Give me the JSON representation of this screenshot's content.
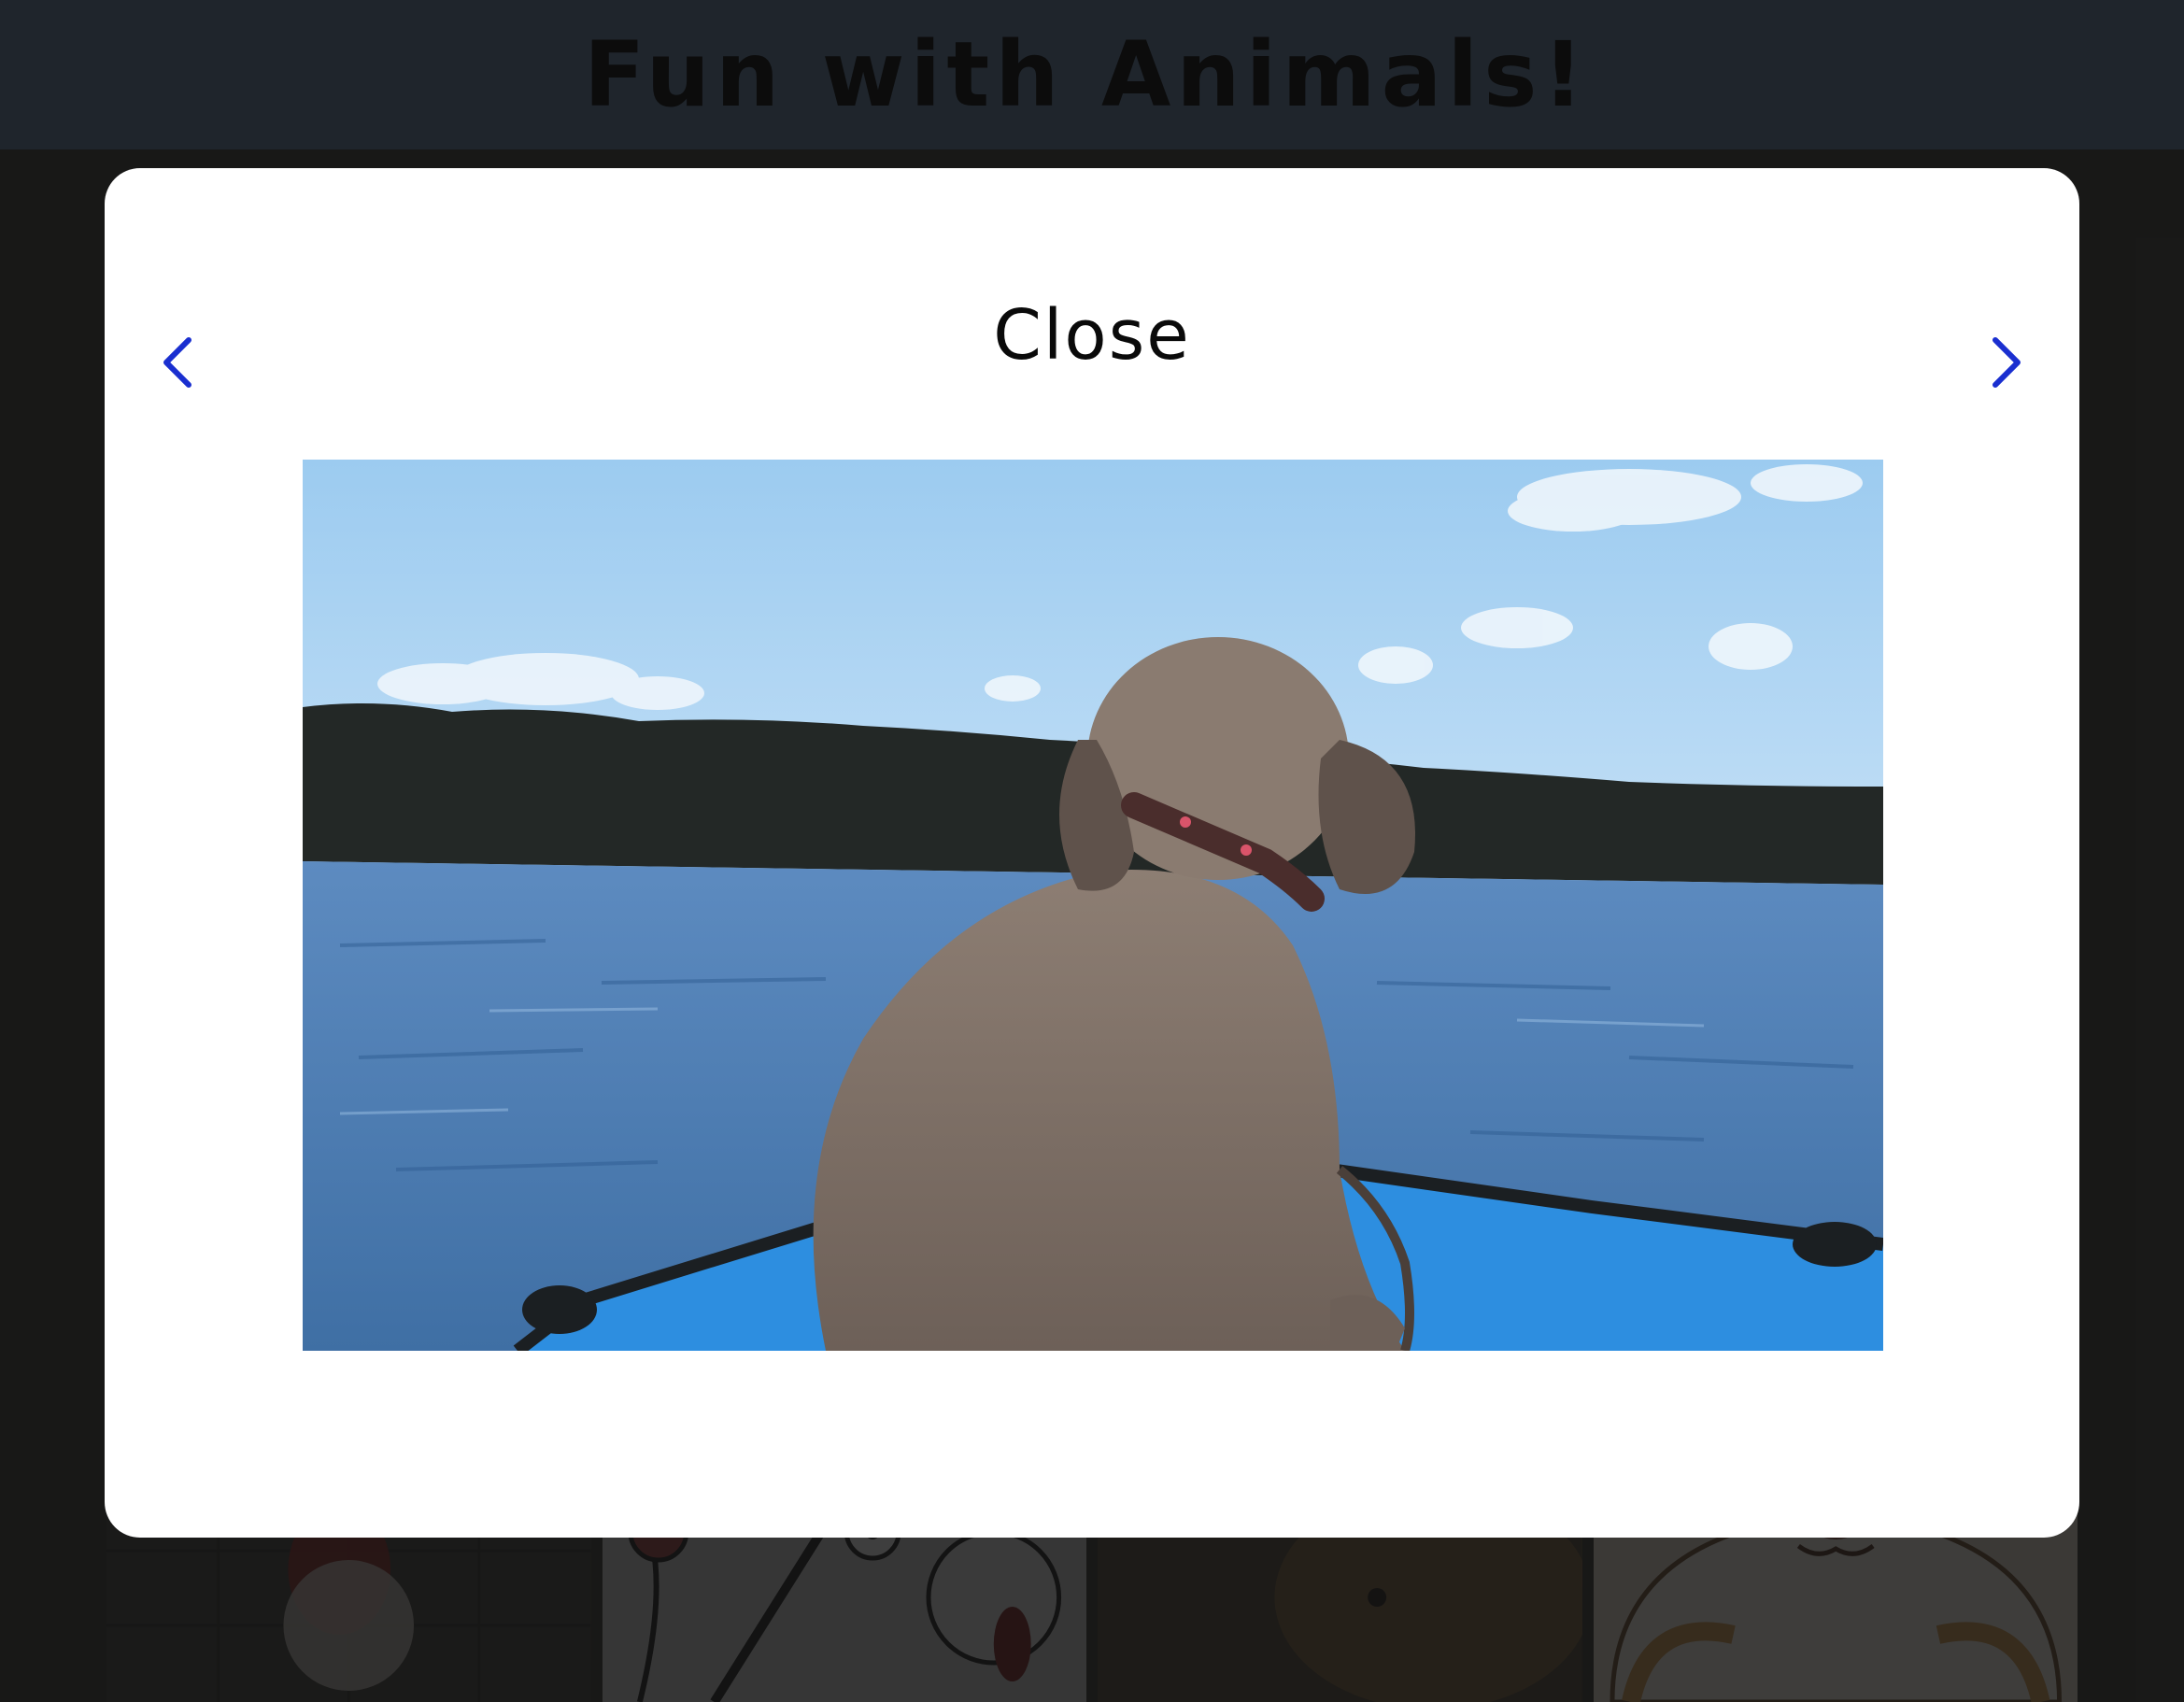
{
  "header": {
    "title": "Fun with Animals!"
  },
  "modal": {
    "close_label": "Close",
    "prev_icon": "chevron-left-icon",
    "next_icon": "chevron-right-icon",
    "image_alt": ""
  },
  "colors": {
    "header_bg": "#1f252c",
    "overlay": "#2e2d2b",
    "modal_bg": "#ffffff",
    "nav_arrow": "#1a2fd0",
    "sky": "#a9d2f2",
    "water": "#4e7fb4",
    "trees": "#232826",
    "dog": "#8b7b70",
    "boat": "#2d8ee0"
  },
  "gallery": {
    "thumbnails": [
      {
        "name": "thumb-dog-santa-hat"
      },
      {
        "name": "thumb-cartoon-animals"
      },
      {
        "name": "thumb-brown-dog"
      },
      {
        "name": "thumb-cartoon-hamster"
      }
    ]
  }
}
